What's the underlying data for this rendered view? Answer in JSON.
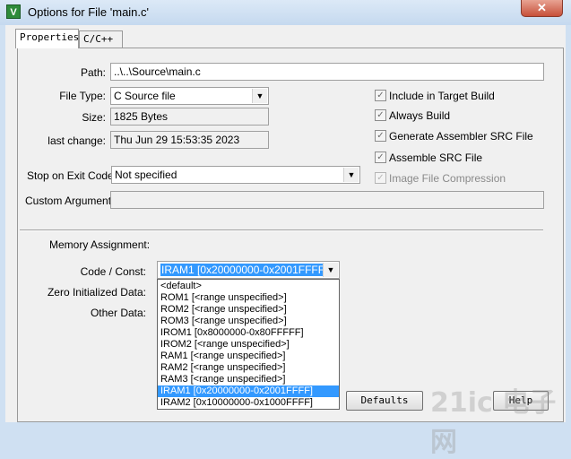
{
  "window": {
    "title": "Options for File 'main.c'",
    "close_glyph": "✕",
    "app_icon_glyph": "V"
  },
  "tabs": [
    {
      "label": "Properties"
    },
    {
      "label": "C/C++"
    }
  ],
  "fields": {
    "path_label": "Path:",
    "path_value": "..\\..\\Source\\main.c",
    "file_type_label": "File Type:",
    "file_type_value": "C Source file",
    "size_label": "Size:",
    "size_value": "1825 Bytes",
    "last_change_label": "last change:",
    "last_change_value": "Thu Jun 29 15:53:35 2023",
    "stop_label": "Stop on Exit Code:",
    "stop_value": "Not specified",
    "custom_args_label": "Custom Arguments:",
    "custom_args_value": ""
  },
  "checkboxes": [
    {
      "label": "Include in Target Build",
      "checked": true,
      "enabled": true
    },
    {
      "label": "Always Build",
      "checked": true,
      "enabled": true
    },
    {
      "label": "Generate Assembler SRC File",
      "checked": true,
      "enabled": true
    },
    {
      "label": "Assemble SRC File",
      "checked": true,
      "enabled": true
    },
    {
      "label": "Image File Compression",
      "checked": true,
      "enabled": false
    }
  ],
  "memory": {
    "section_label": "Memory Assignment:",
    "code_const_label": "Code / Const:",
    "code_const_value": "IRAM1 [0x20000000-0x2001FFFF]",
    "zero_init_label": "Zero Initialized Data:",
    "other_data_label": "Other Data:",
    "options": [
      "<default>",
      "ROM1 [<range unspecified>]",
      "ROM2 [<range unspecified>]",
      "ROM3 [<range unspecified>]",
      "IROM1 [0x8000000-0x80FFFFF]",
      "IROM2 [<range unspecified>]",
      "RAM1 [<range unspecified>]",
      "RAM2 [<range unspecified>]",
      "RAM3 [<range unspecified>]",
      "IRAM1 [0x20000000-0x2001FFFF]",
      "IRAM2 [0x10000000-0x1000FFFF]"
    ],
    "highlighted_option": "IRAM1 [0x20000000-0x2001FFFF]"
  },
  "buttons": {
    "defaults": "Defaults",
    "help": "Help"
  },
  "watermark": "21ic 电子网",
  "colors": {
    "selection": "#3399ff",
    "titlebar": "#c5d9ef",
    "close": "#c7503a"
  }
}
